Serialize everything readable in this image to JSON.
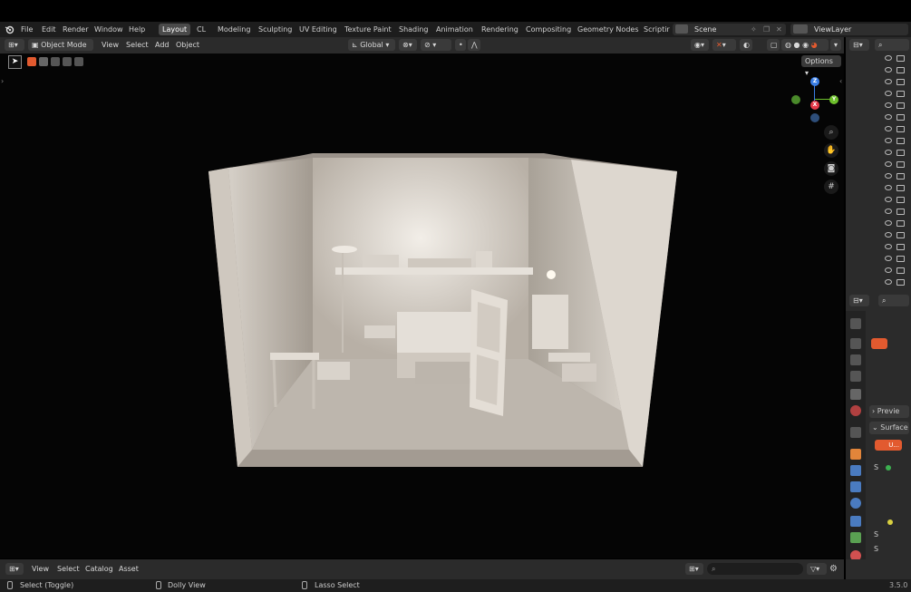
{
  "menu": {
    "file": "File",
    "edit": "Edit",
    "render": "Render",
    "window": "Window",
    "help": "Help"
  },
  "workspaces": [
    "Layout",
    "CL",
    "Modeling",
    "Sculpting",
    "UV Editing",
    "Texture Paint",
    "Shading",
    "Animation",
    "Rendering",
    "Compositing",
    "Geometry Nodes",
    "Scriptir"
  ],
  "active_workspace": "Layout",
  "scene": {
    "label": "Scene"
  },
  "view_layer": {
    "label": "ViewLayer"
  },
  "header": {
    "mode": "Object Mode",
    "view": "View",
    "select": "Select",
    "add": "Add",
    "object": "Object",
    "transform": "Global",
    "options": "Options"
  },
  "gizmo": {
    "z": "Z",
    "y": "Y",
    "x": "X"
  },
  "properties": {
    "preview": "Previe",
    "surface": "Surface",
    "material_slot": "U...",
    "s1": "S",
    "s2": "S",
    "s3": "S"
  },
  "bottom": {
    "view": "View",
    "select": "Select",
    "catalog": "Catalog",
    "asset": "Asset"
  },
  "status": {
    "select_toggle": "Select (Toggle)",
    "dolly": "Dolly View",
    "lasso": "Lasso Select",
    "version": "3.5.0"
  },
  "colors": {
    "accent": "#4772b3",
    "active_tab": "#4a4a4a",
    "axis_x": "#e53a4a",
    "axis_y": "#6dbf2b",
    "axis_z": "#3a7ee5",
    "material": "#e25a2f"
  },
  "icons": {
    "blender": "blender-logo-icon",
    "zoom": "magnifier-icon",
    "pan": "hand-icon",
    "camera": "camera-icon",
    "grid": "grid-icon"
  }
}
